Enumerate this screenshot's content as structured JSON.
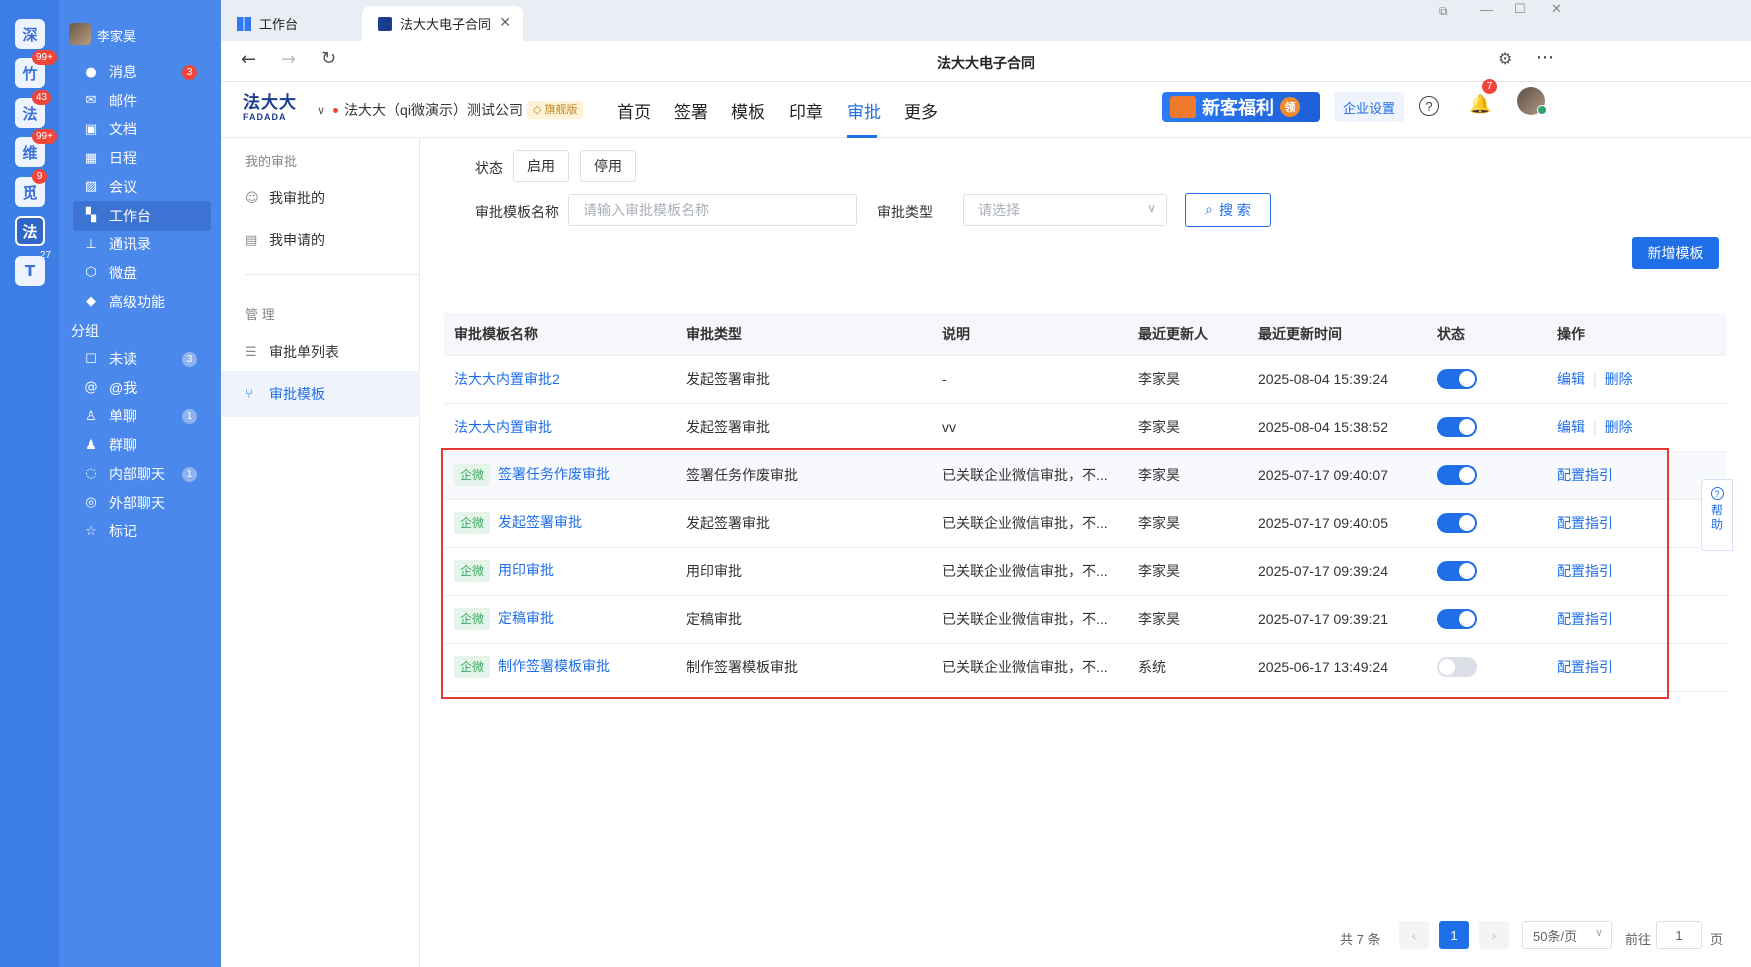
{
  "rail": {
    "icons": [
      {
        "label": "深",
        "badge": ""
      },
      {
        "label": "竹",
        "badge": "99+"
      },
      {
        "label": "法",
        "badge": "43"
      },
      {
        "label": "维",
        "badge": "99+"
      },
      {
        "label": "觅",
        "badge": "9"
      },
      {
        "label": "法",
        "badge": ""
      },
      {
        "label": "T",
        "badge": "27"
      }
    ]
  },
  "sidebar": {
    "user_name": "李家昊",
    "items": [
      {
        "label": "消息",
        "icon": "chat-bubble-icon",
        "badge": "3"
      },
      {
        "label": "邮件",
        "icon": "mail-icon",
        "badge": ""
      },
      {
        "label": "文档",
        "icon": "document-icon",
        "badge": ""
      },
      {
        "label": "日程",
        "icon": "calendar-icon",
        "badge": ""
      },
      {
        "label": "会议",
        "icon": "meeting-icon",
        "badge": ""
      },
      {
        "label": "工作台",
        "icon": "grid-icon",
        "badge": ""
      },
      {
        "label": "通讯录",
        "icon": "org-chart-icon",
        "badge": ""
      },
      {
        "label": "微盘",
        "icon": "cloud-drive-icon",
        "badge": ""
      },
      {
        "label": "高级功能",
        "icon": "premium-icon",
        "badge": ""
      }
    ],
    "group_title": "分组",
    "group_items": [
      {
        "label": "未读",
        "icon": "unread-icon",
        "badge": "3"
      },
      {
        "label": "@我",
        "icon": "at-icon",
        "badge": ""
      },
      {
        "label": "单聊",
        "icon": "person-icon",
        "badge": "1"
      },
      {
        "label": "群聊",
        "icon": "group-icon",
        "badge": ""
      },
      {
        "label": "内部聊天",
        "icon": "chat-icon",
        "badge": "1"
      },
      {
        "label": "外部聊天",
        "icon": "external-chat-icon",
        "badge": ""
      },
      {
        "label": "标记",
        "icon": "star-icon",
        "badge": ""
      }
    ]
  },
  "browser": {
    "tabs": [
      {
        "label": "工作台"
      },
      {
        "label": "法大大电子合同"
      }
    ],
    "page_title": "法大大电子合同"
  },
  "appnav": {
    "logo_cn": "法大大",
    "logo_en": "FADADA",
    "company": "法大大（qi微演示）测试公司",
    "edition": "旗舰版",
    "tabs": [
      "首页",
      "签署",
      "模板",
      "印章",
      "审批",
      "更多"
    ],
    "active_tab": "审批",
    "promo": "新客福利",
    "promo_badge": "领",
    "settings": "企业设置",
    "notif_count": "7"
  },
  "leftmenu": {
    "group1": "我的审批",
    "item1": "我审批的",
    "item2": "我申请的",
    "group2": "管 理",
    "item3": "审批单列表",
    "item4": "审批模板"
  },
  "filters": {
    "status_label": "状态",
    "enable": "启用",
    "disable": "停用",
    "name_label": "审批模板名称",
    "name_placeholder": "请输入审批模板名称",
    "type_label": "审批类型",
    "type_placeholder": "请选择",
    "search": "搜 索",
    "add": "新增模板"
  },
  "table": {
    "headers": [
      "审批模板名称",
      "审批类型",
      "说明",
      "最近更新人",
      "最近更新时间",
      "状态",
      "操作"
    ],
    "rows": [
      {
        "tag": "",
        "name": "法大大内置审批2",
        "type": "发起签署审批",
        "desc": "-",
        "updater": "李家昊",
        "time": "2025-08-04 15:39:24",
        "status": "on",
        "ops": [
          "编辑",
          "删除"
        ]
      },
      {
        "tag": "",
        "name": "法大大内置审批",
        "type": "发起签署审批",
        "desc": "vv",
        "updater": "李家昊",
        "time": "2025-08-04 15:38:52",
        "status": "on",
        "ops": [
          "编辑",
          "删除"
        ]
      },
      {
        "tag": "企微",
        "name": "签署任务作废审批",
        "type": "签署任务作废审批",
        "desc": "已关联企业微信审批，不...",
        "updater": "李家昊",
        "time": "2025-07-17 09:40:07",
        "status": "on",
        "ops": [
          "配置指引"
        ]
      },
      {
        "tag": "企微",
        "name": "发起签署审批",
        "type": "发起签署审批",
        "desc": "已关联企业微信审批，不...",
        "updater": "李家昊",
        "time": "2025-07-17 09:40:05",
        "status": "on",
        "ops": [
          "配置指引"
        ]
      },
      {
        "tag": "企微",
        "name": "用印审批",
        "type": "用印审批",
        "desc": "已关联企业微信审批，不...",
        "updater": "李家昊",
        "time": "2025-07-17 09:39:24",
        "status": "on",
        "ops": [
          "配置指引"
        ]
      },
      {
        "tag": "企微",
        "name": "定稿审批",
        "type": "定稿审批",
        "desc": "已关联企业微信审批，不...",
        "updater": "李家昊",
        "time": "2025-07-17 09:39:21",
        "status": "on",
        "ops": [
          "配置指引"
        ]
      },
      {
        "tag": "企微",
        "name": "制作签署模板审批",
        "type": "制作签署模板审批",
        "desc": "已关联企业微信审批，不...",
        "updater": "系统",
        "time": "2025-06-17 13:49:24",
        "status": "off",
        "ops": [
          "配置指引"
        ]
      }
    ]
  },
  "pagination": {
    "total": "共 7 条",
    "current": "1",
    "page_size": "50条/页",
    "goto_label": "前往",
    "goto_value": "1",
    "page_suffix": "页"
  },
  "help": {
    "label": "帮助"
  },
  "colors": {
    "primary": "#1f6fe8",
    "sidebar": "#4a88ec",
    "highlight": "#e53935"
  }
}
